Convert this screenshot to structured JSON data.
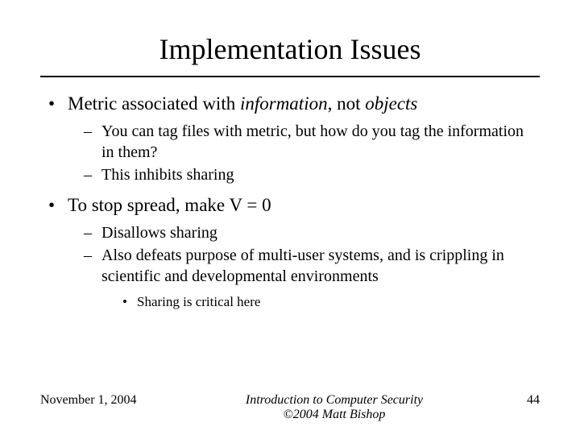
{
  "title": "Implementation Issues",
  "bullets": {
    "b1_prefix": "Metric associated with ",
    "b1_word1": "information",
    "b1_mid": ", not ",
    "b1_word2": "objects",
    "b1_sub1": "You can tag files with metric, but how do you tag the information in them?",
    "b1_sub2": "This inhibits sharing",
    "b2": "To stop spread, make V = 0",
    "b2_sub1": "Disallows sharing",
    "b2_sub2": "Also defeats purpose of multi-user systems, and is crippling in scientific and developmental environments",
    "b2_sub2_sub1": "Sharing is critical here"
  },
  "footer": {
    "date": "November 1, 2004",
    "center_line1": "Introduction to Computer Security",
    "center_line2": "©2004 Matt Bishop",
    "page": "44"
  }
}
